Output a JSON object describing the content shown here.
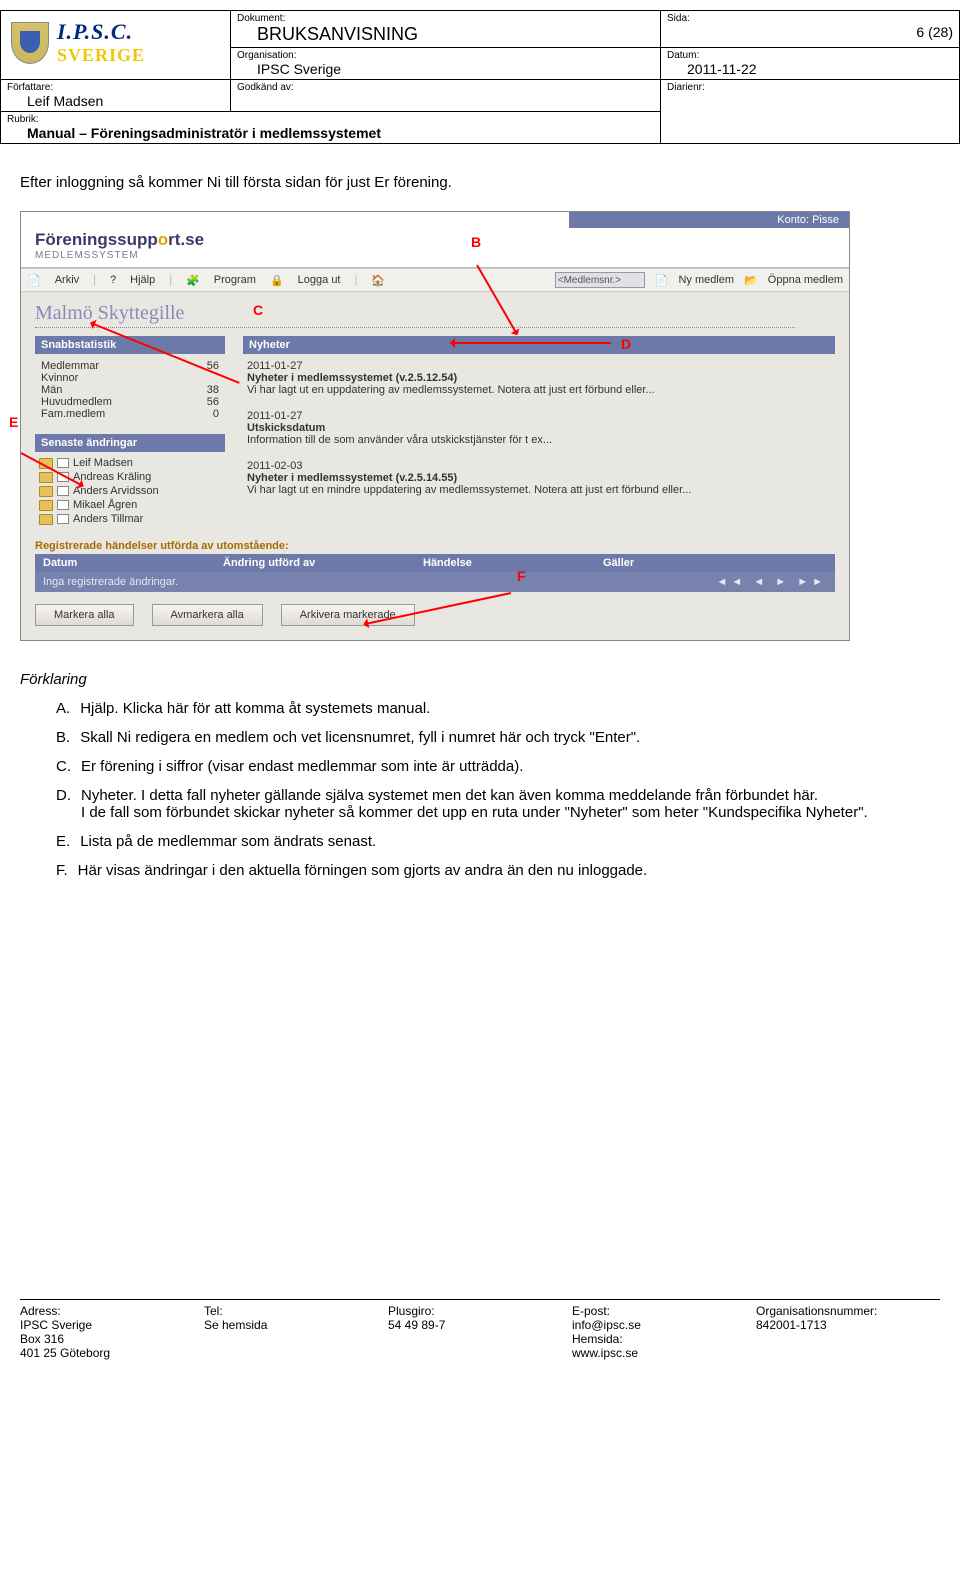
{
  "header": {
    "dokument_lbl": "Dokument:",
    "dokument_val": "BRUKSANVISNING",
    "sida_lbl": "Sida:",
    "sida_val": "6 (28)",
    "org_lbl": "Organisation:",
    "org_val": "IPSC Sverige",
    "datum_lbl": "Datum:",
    "datum_val": "2011-11-22",
    "forf_lbl": "Författare:",
    "forf_val": "Leif Madsen",
    "godk_lbl": "Godkänd av:",
    "rubrik_lbl": "Rubrik:",
    "rubrik_val": "Manual – Föreningsadministratör i medlemssystemet",
    "diarie_lbl": "Diarienr:",
    "logo_ipsc": "I.P.S.C.",
    "logo_sv": "SVERIGE"
  },
  "intro": "Efter inloggning så kommer Ni till första sidan för just Er förening.",
  "shot": {
    "konto": "Konto: Pisse",
    "fs_name_a": "Föreningssupp",
    "fs_name_b": "rt.se",
    "fs_sub": "MEDLEMSSYSTEM",
    "menu": {
      "arkiv": "Arkiv",
      "hjalp": "Hjälp",
      "program": "Program",
      "logga": "Logga ut",
      "search_placeholder": "<Medlemsnr.>",
      "nymed": "Ny medlem",
      "oppna": "Öppna medlem"
    },
    "gille": "Malmö Skyttegille",
    "stats_hdr": "Snabbstatistik",
    "stats": [
      {
        "k": "Medlemmar",
        "v": "56"
      },
      {
        "k": "Kvinnor",
        "v": ""
      },
      {
        "k": "Män",
        "v": "38"
      },
      {
        "k": "Huvudmedlem",
        "v": "56"
      },
      {
        "k": "Fam.medlem",
        "v": "0"
      }
    ],
    "senaste_hdr": "Senaste ändringar",
    "names": [
      "Leif Madsen",
      "Andreas Kräling",
      "Anders Arvidsson",
      "Mikael Ågren",
      "Anders Tillmar"
    ],
    "nyheter_hdr": "Nyheter",
    "news": [
      {
        "date": "2011-01-27",
        "title": "Nyheter i medlemssystemet (v.2.5.12.54)",
        "body": "Vi har lagt ut en uppdatering av medlemssystemet. Notera att just ert förbund eller..."
      },
      {
        "date": "2011-01-27",
        "title": "Utskicksdatum",
        "body": "Information till de som använder våra utskickstjänster för t ex..."
      },
      {
        "date": "2011-02-03",
        "title": "Nyheter i medlemssystemet (v.2.5.14.55)",
        "body": "Vi har lagt ut en mindre uppdatering av medlemssystemet. Notera att just ert förbund eller..."
      }
    ],
    "reg_hdr": "Registrerade händelser utförda av utomstående:",
    "th": {
      "c1": "Datum",
      "c2": "Ändring utförd av",
      "c3": "Händelse",
      "c4": "Gäller"
    },
    "norow": "Inga registrerade ändringar.",
    "pager": "◄◄  ◄  ►  ►►",
    "btns": {
      "a": "Markera alla",
      "b": "Avmarkera alla",
      "c": "Arkivera markerade"
    },
    "letters": {
      "B": "B",
      "C": "C",
      "D": "D",
      "E": "E",
      "F": "F"
    }
  },
  "fk_head": "Förklaring",
  "fk": [
    {
      "t": "A.",
      "b": "Hjälp. Klicka här för att komma åt systemets manual."
    },
    {
      "t": "B.",
      "b": "Skall Ni redigera en medlem och vet licensnumret, fyll i numret här och tryck \"Enter\"."
    },
    {
      "t": "C.",
      "b": "Er förening i siffror (visar endast medlemmar som inte är utträdda)."
    },
    {
      "t": "D.",
      "b": "Nyheter. I detta fall nyheter gällande själva systemet men det kan även komma meddelande från förbundet här.\nI de fall som förbundet skickar nyheter så kommer det upp en ruta under \"Nyheter\" som heter \"Kundspecifika Nyheter\"."
    },
    {
      "t": "E.",
      "b": "Lista på de medlemmar som ändrats senast."
    },
    {
      "t": "F.",
      "b": "Här visas ändringar i den aktuella förningen som gjorts av andra än den nu inloggade."
    }
  ],
  "footer": {
    "adr_lbl": "Adress:",
    "adr1": "IPSC Sverige",
    "adr2": "Box 316",
    "adr3": "401 25 Göteborg",
    "tel_lbl": "Tel:",
    "tel": "Se hemsida",
    "pg_lbl": "Plusgiro:",
    "pg": "54 49 89-7",
    "ep_lbl": "E-post:",
    "ep": "info@ipsc.se",
    "hem_lbl": "Hemsida:",
    "hem": "www.ipsc.se",
    "org_lbl": "Organisationsnummer:",
    "org": "842001-1713"
  }
}
